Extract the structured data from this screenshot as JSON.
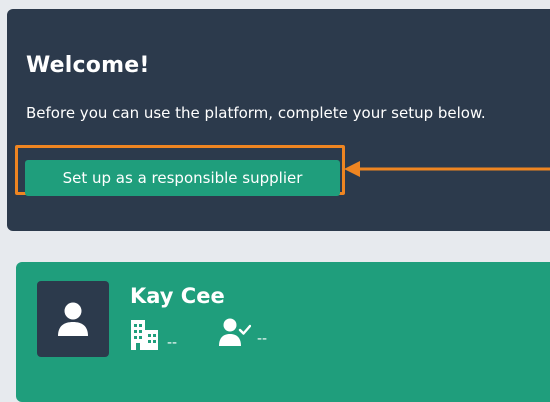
{
  "welcome": {
    "title": "Welcome!",
    "message": "Before you can use the platform, complete your setup below.",
    "setup_button_label": "Set up as a responsible supplier"
  },
  "profile": {
    "name": "Kay Cee",
    "organization_icon": "building-icon",
    "organization_value": "--",
    "user_icon": "user-check-icon",
    "user_value": "--"
  },
  "colors": {
    "dark_card": "#2c3a4c",
    "accent_green": "#1f9e7c",
    "highlight_orange": "#ef8521",
    "page_background": "#e7eaee"
  }
}
